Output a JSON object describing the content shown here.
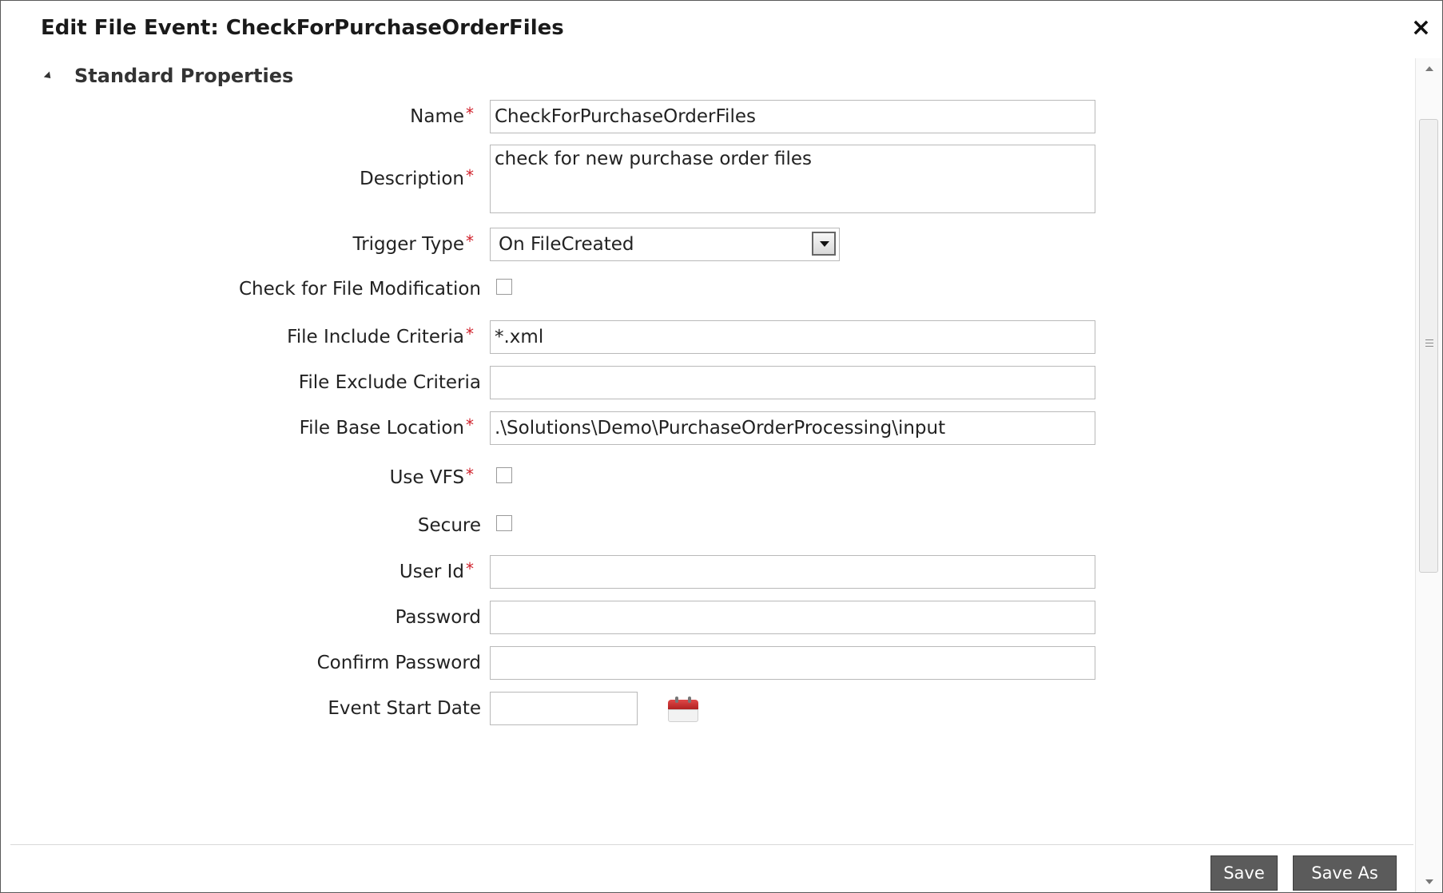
{
  "dialog": {
    "title": "Edit File Event: CheckForPurchaseOrderFiles",
    "close_glyph": "×"
  },
  "section": {
    "title": "Standard Properties"
  },
  "required_marker": "*",
  "fields": {
    "name": {
      "label": "Name",
      "value": "CheckForPurchaseOrderFiles"
    },
    "description": {
      "label": "Description",
      "value": "check for new purchase order files"
    },
    "trigger_type": {
      "label": "Trigger Type",
      "value": "On FileCreated"
    },
    "check_modification": {
      "label": "Check for File Modification",
      "checked": false
    },
    "include_criteria": {
      "label": "File Include Criteria",
      "value": "*.xml"
    },
    "exclude_criteria": {
      "label": "File Exclude Criteria",
      "value": ""
    },
    "base_location": {
      "label": "File Base Location",
      "value": ".\\Solutions\\Demo\\PurchaseOrderProcessing\\input"
    },
    "use_vfs": {
      "label": "Use VFS",
      "checked": false
    },
    "secure": {
      "label": "Secure",
      "checked": false
    },
    "user_id": {
      "label": "User Id",
      "value": ""
    },
    "password": {
      "label": "Password",
      "value": ""
    },
    "confirm_password": {
      "label": "Confirm Password",
      "value": ""
    },
    "event_start_date": {
      "label": "Event Start Date",
      "value": ""
    }
  },
  "buttons": {
    "save": "Save",
    "save_as": "Save As"
  },
  "icons": {
    "collapse": "triangle-down-icon",
    "calendar": "calendar-icon",
    "close": "close-icon"
  },
  "colors": {
    "required": "#d0202a",
    "button_bg": "#5b5b5b"
  }
}
